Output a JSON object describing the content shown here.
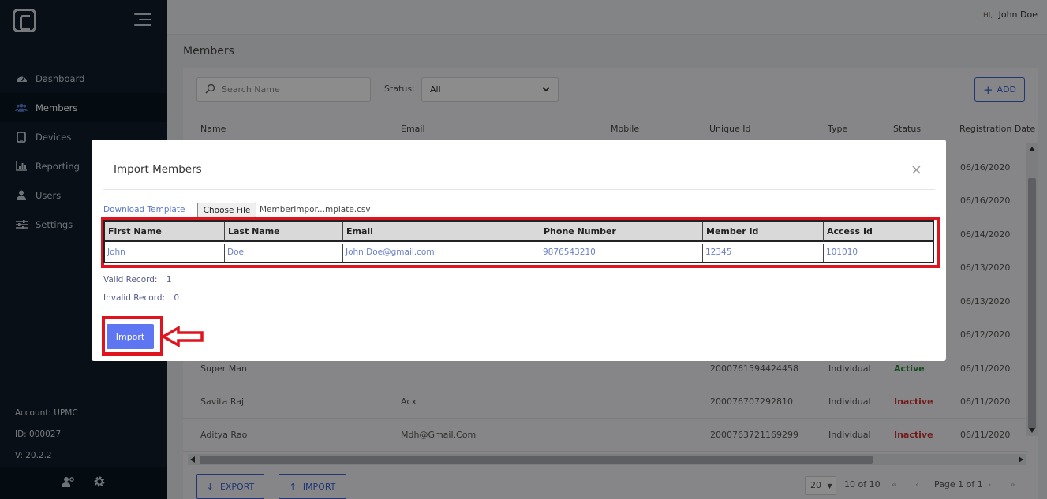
{
  "sidebar": {
    "items": [
      {
        "label": "Dashboard",
        "icon": "dashboard-icon"
      },
      {
        "label": "Members",
        "icon": "users-icon"
      },
      {
        "label": "Devices",
        "icon": "tablet-icon"
      },
      {
        "label": "Reporting",
        "icon": "bar-chart-icon"
      },
      {
        "label": "Users",
        "icon": "user-icon"
      },
      {
        "label": "Settings",
        "icon": "sliders-icon"
      }
    ],
    "account": "Account: UPMC",
    "id": "ID: 000027",
    "version": "V: 20.2.2"
  },
  "header": {
    "hi": "Hi,",
    "user": "John Doe"
  },
  "page": {
    "title": "Members",
    "search_placeholder": "Search Name",
    "status_label": "Status:",
    "status_value": "All",
    "add_label": "ADD",
    "columns": [
      "Name",
      "Email",
      "Mobile",
      "Unique Id",
      "Type",
      "Status",
      "Registration Date"
    ],
    "background_dates": [
      "06/16/2020",
      "06/16/2020",
      "06/14/2020",
      "06/13/2020",
      "06/13/2020",
      "06/12/2020"
    ],
    "rows": [
      {
        "name": "Super Man",
        "email": "",
        "mobile": "",
        "unique_id": "2000761594424458",
        "type": "Individual",
        "status": "Active",
        "date": "06/11/2020"
      },
      {
        "name": "Savita Raj",
        "email": "Acx",
        "mobile": "",
        "unique_id": "2000767072928​10",
        "type": "Individual",
        "status": "Inactive",
        "date": "06/11/2020"
      },
      {
        "name": "Aditya Rao",
        "email": "Mdh@Gmail.Com",
        "mobile": "",
        "unique_id": "2000763721169299",
        "type": "Individual",
        "status": "Inactive",
        "date": "06/11/2020"
      }
    ],
    "export_label": "EXPORT",
    "import_label": "IMPORT",
    "page_size": "20",
    "count_text": "10 of 10",
    "page_text": "Page 1 of 1"
  },
  "modal": {
    "title": "Import Members",
    "download_template": "Download Template",
    "choose_file": "Choose File",
    "file_name": "MemberImpor...mplate.csv",
    "preview_headers": [
      "First Name",
      "Last Name",
      "Email",
      "Phone Number",
      "Member Id",
      "Access Id"
    ],
    "preview_row": [
      "John",
      "Doe",
      "John.Doe@gmail.com",
      "9876543210",
      "12345",
      "101010"
    ],
    "valid_label": "Valid Record:",
    "valid_count": "1",
    "invalid_label": "Invalid Record:",
    "invalid_count": "0",
    "import_button": "Import"
  },
  "colors": {
    "accent": "#3b63d6",
    "annotation_red": "#e0141f",
    "sidebar": "#0f1d2b"
  }
}
